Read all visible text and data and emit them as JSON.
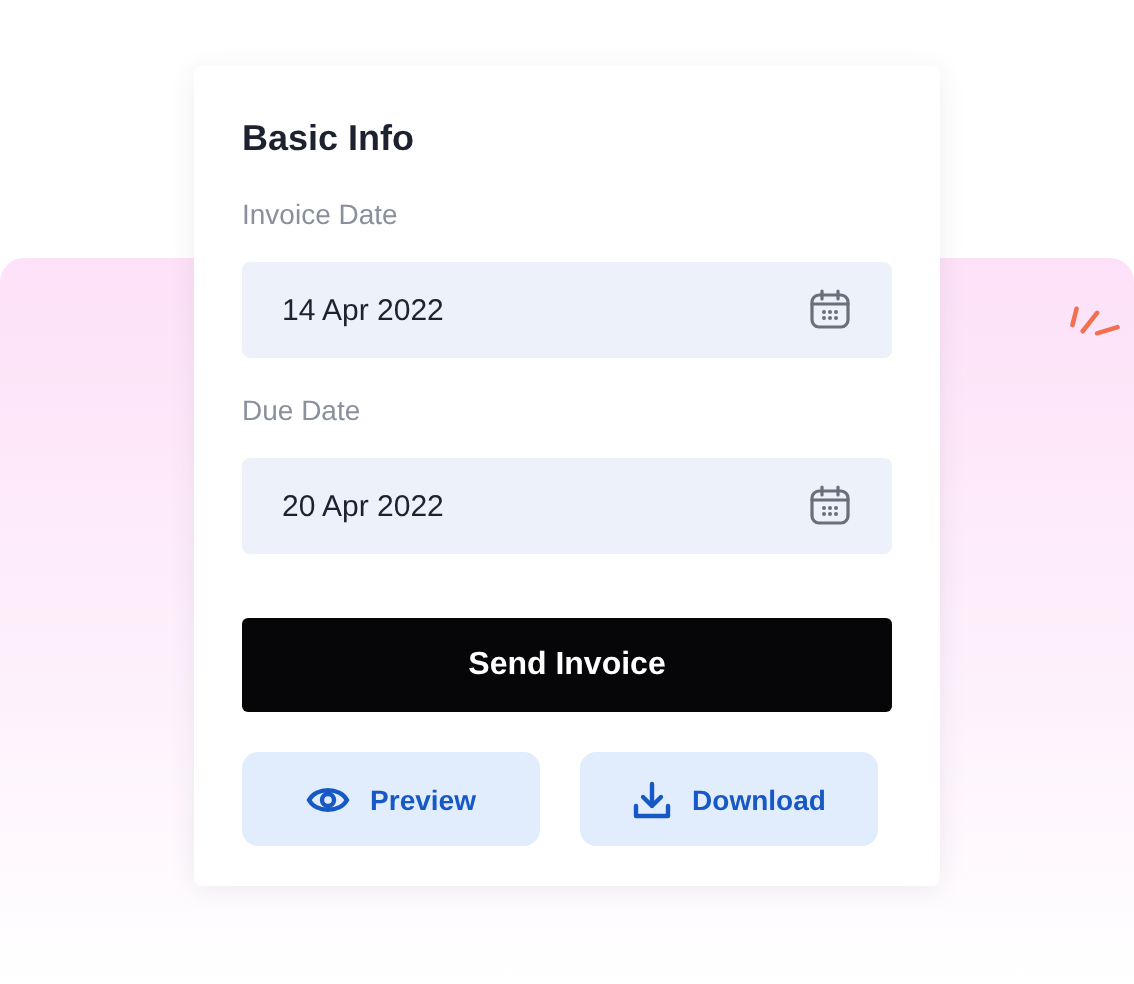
{
  "card": {
    "title": "Basic Info",
    "fields": [
      {
        "label": "Invoice Date",
        "value": "14 Apr 2022"
      },
      {
        "label": "Due Date",
        "value": "20 Apr 2022"
      }
    ],
    "primary_button": "Send Invoice",
    "secondary_buttons": [
      {
        "label": "Preview",
        "kind": "preview"
      },
      {
        "label": "Download",
        "kind": "download"
      }
    ]
  }
}
